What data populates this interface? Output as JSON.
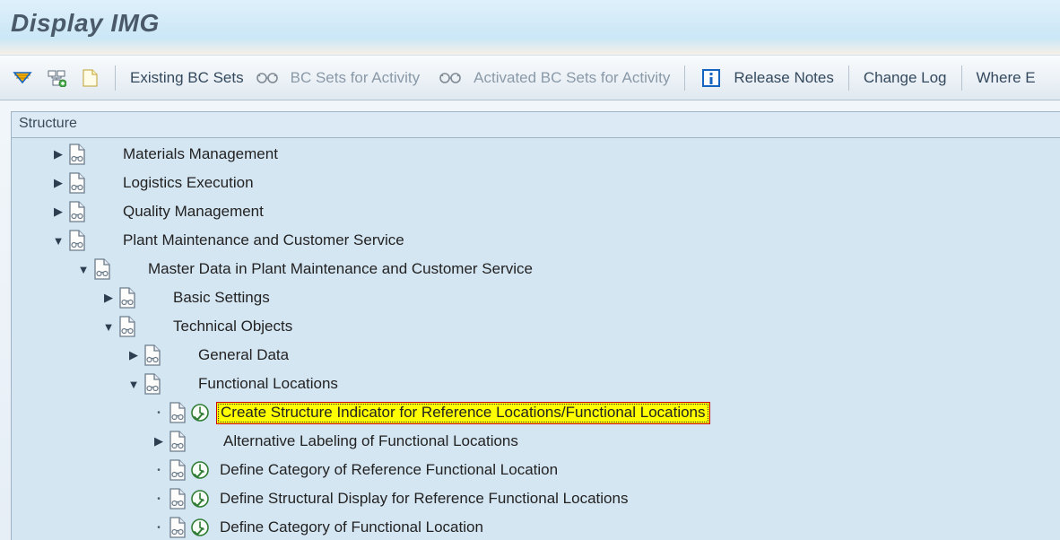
{
  "title": "Display IMG",
  "toolbar": {
    "existing_bc_sets": "Existing BC Sets",
    "bc_sets_activity": "BC Sets for Activity",
    "activated_bc_sets": "Activated BC Sets for Activity",
    "release_notes": "Release Notes",
    "change_log": "Change Log",
    "where": "Where E"
  },
  "structure": {
    "header": "Structure"
  },
  "tree": {
    "items": [
      {
        "indent": 1,
        "toggle": "closed",
        "doc": true,
        "clock": false,
        "label": "Materials Management",
        "hl": false
      },
      {
        "indent": 1,
        "toggle": "closed",
        "doc": true,
        "clock": false,
        "label": "Logistics Execution",
        "hl": false
      },
      {
        "indent": 1,
        "toggle": "closed",
        "doc": true,
        "clock": false,
        "label": "Quality Management",
        "hl": false
      },
      {
        "indent": 1,
        "toggle": "open",
        "doc": true,
        "clock": false,
        "label": "Plant Maintenance and Customer Service",
        "hl": false
      },
      {
        "indent": 2,
        "toggle": "open",
        "doc": true,
        "clock": false,
        "label": "Master Data in Plant Maintenance and Customer Service",
        "hl": false
      },
      {
        "indent": 3,
        "toggle": "closed",
        "doc": true,
        "clock": false,
        "label": "Basic Settings",
        "hl": false
      },
      {
        "indent": 3,
        "toggle": "open",
        "doc": true,
        "clock": false,
        "label": "Technical Objects",
        "hl": false
      },
      {
        "indent": 4,
        "toggle": "closed",
        "doc": true,
        "clock": false,
        "label": "General Data",
        "hl": false
      },
      {
        "indent": 4,
        "toggle": "open",
        "doc": true,
        "clock": false,
        "label": "Functional Locations",
        "hl": false
      },
      {
        "indent": 5,
        "toggle": "leaf",
        "doc": true,
        "clock": true,
        "label": "Create Structure Indicator for Reference Locations/Functional Locations",
        "hl": true
      },
      {
        "indent": 5,
        "toggle": "closed",
        "doc": true,
        "clock": false,
        "label": "Alternative Labeling of Functional Locations",
        "hl": false
      },
      {
        "indent": 5,
        "toggle": "leaf",
        "doc": true,
        "clock": true,
        "label": "Define Category of Reference Functional Location",
        "hl": false
      },
      {
        "indent": 5,
        "toggle": "leaf",
        "doc": true,
        "clock": true,
        "label": "Define Structural Display for Reference Functional Locations",
        "hl": false
      },
      {
        "indent": 5,
        "toggle": "leaf",
        "doc": true,
        "clock": true,
        "label": "Define Category of Functional Location",
        "hl": false
      }
    ]
  }
}
